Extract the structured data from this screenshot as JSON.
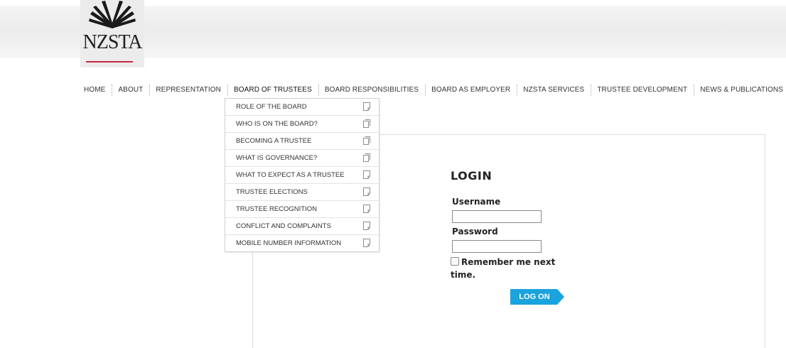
{
  "logo": {
    "text": "NZSTA",
    "icon": "book-icon",
    "underline_color": "#c8283c"
  },
  "nav": {
    "items": [
      {
        "label": "HOME"
      },
      {
        "label": "ABOUT"
      },
      {
        "label": "REPRESENTATION"
      },
      {
        "label": "BOARD OF TRUSTEES",
        "active": true
      },
      {
        "label": "BOARD RESPONSIBILITIES"
      },
      {
        "label": "BOARD AS EMPLOYER"
      },
      {
        "label": "NZSTA SERVICES"
      },
      {
        "label": "TRUSTEE DEVELOPMENT"
      },
      {
        "label": "NEWS & PUBLICATIONS"
      }
    ]
  },
  "dropdown": {
    "items": [
      {
        "label": "ROLE OF THE BOARD",
        "icon": "page-icon"
      },
      {
        "label": "WHO IS ON THE BOARD?",
        "icon": "pages-icon"
      },
      {
        "label": "BECOMING A TRUSTEE",
        "icon": "pages-icon"
      },
      {
        "label": "WHAT IS GOVERNANCE?",
        "icon": "pages-icon"
      },
      {
        "label": "WHAT TO EXPECT AS A TRUSTEE",
        "icon": "page-icon"
      },
      {
        "label": "TRUSTEE ELECTIONS",
        "icon": "page-icon"
      },
      {
        "label": "TRUSTEE RECOGNITION",
        "icon": "page-icon"
      },
      {
        "label": "CONFLICT AND COMPLAINTS",
        "icon": "page-icon"
      },
      {
        "label": "MOBILE NUMBER INFORMATION",
        "icon": "page-icon"
      }
    ]
  },
  "login": {
    "title": "LOGIN",
    "username_label": "Username",
    "username_value": "",
    "password_label": "Password",
    "password_value": "",
    "remember_label": "Remember me next time.",
    "remember_checked": false,
    "button_label": "LOG ON",
    "button_color": "#1aa3dc"
  }
}
